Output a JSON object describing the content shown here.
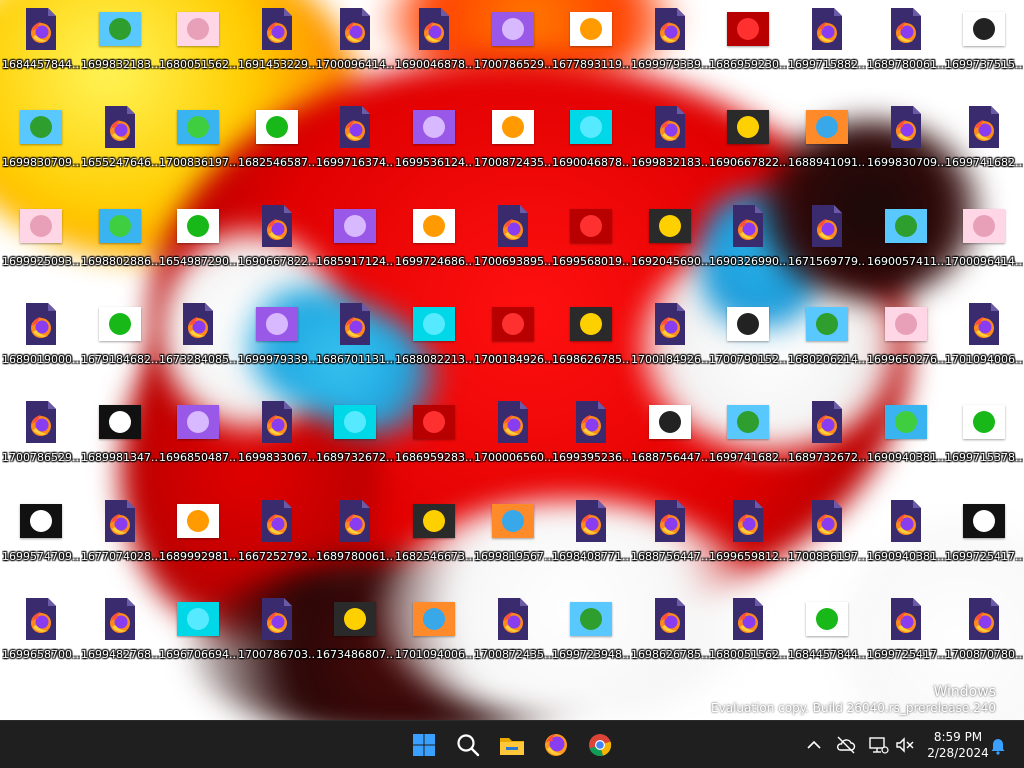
{
  "desktop": {
    "icons": [
      {
        "label": "1684457844....",
        "kind": "firefox-icon"
      },
      {
        "label": "1699832183....",
        "kind": "image"
      },
      {
        "label": "1680051562....",
        "kind": "image"
      },
      {
        "label": "1691453229....",
        "kind": "firefox-icon"
      },
      {
        "label": "1700096414....",
        "kind": "firefox-icon"
      },
      {
        "label": "1690046878....",
        "kind": "firefox-icon"
      },
      {
        "label": "1700786529....",
        "kind": "image"
      },
      {
        "label": "1677893119....",
        "kind": "image"
      },
      {
        "label": "1699979339....",
        "kind": "firefox-icon"
      },
      {
        "label": "1686959230....",
        "kind": "image"
      },
      {
        "label": "1699715882....",
        "kind": "firefox-icon"
      },
      {
        "label": "1689780061....",
        "kind": "firefox-icon"
      },
      {
        "label": "1699737515....",
        "kind": "image"
      },
      {
        "label": "1699830709....",
        "kind": "image"
      },
      {
        "label": "1655247646....",
        "kind": "firefox-icon"
      },
      {
        "label": "1700836197....",
        "kind": "image"
      },
      {
        "label": "1682546587....",
        "kind": "image"
      },
      {
        "label": "1699716374....",
        "kind": "firefox-icon"
      },
      {
        "label": "1699536124....",
        "kind": "image"
      },
      {
        "label": "1700872435....",
        "kind": "image"
      },
      {
        "label": "1690046878....",
        "kind": "image"
      },
      {
        "label": "1699832183....",
        "kind": "firefox-icon"
      },
      {
        "label": "1690667822....",
        "kind": "image"
      },
      {
        "label": "1688941091....",
        "kind": "image"
      },
      {
        "label": "1699830709....",
        "kind": "firefox-icon"
      },
      {
        "label": "1699741682....",
        "kind": "firefox-icon"
      },
      {
        "label": "1699925093....",
        "kind": "image"
      },
      {
        "label": "1698802886....",
        "kind": "image"
      },
      {
        "label": "1654987290....",
        "kind": "image"
      },
      {
        "label": "1690667822....",
        "kind": "firefox-icon"
      },
      {
        "label": "1685917124....",
        "kind": "image"
      },
      {
        "label": "1699724686....",
        "kind": "image"
      },
      {
        "label": "1700693895....",
        "kind": "firefox-icon"
      },
      {
        "label": "1699568019....",
        "kind": "image"
      },
      {
        "label": "1692045690....",
        "kind": "image"
      },
      {
        "label": "1690326990....",
        "kind": "firefox-icon"
      },
      {
        "label": "1671569779....",
        "kind": "firefox-icon"
      },
      {
        "label": "1690057411....",
        "kind": "image"
      },
      {
        "label": "1700096414....",
        "kind": "image"
      },
      {
        "label": "1689019000....",
        "kind": "firefox-icon"
      },
      {
        "label": "1679184682....",
        "kind": "image"
      },
      {
        "label": "1673284085....",
        "kind": "firefox-icon"
      },
      {
        "label": "1699979339....",
        "kind": "image"
      },
      {
        "label": "1686701131....",
        "kind": "firefox-icon"
      },
      {
        "label": "1688082213....",
        "kind": "image"
      },
      {
        "label": "1700184926....",
        "kind": "image"
      },
      {
        "label": "1698626785....",
        "kind": "image"
      },
      {
        "label": "1700184926....",
        "kind": "firefox-icon"
      },
      {
        "label": "1700790152....",
        "kind": "image"
      },
      {
        "label": "1680206214....",
        "kind": "image"
      },
      {
        "label": "1699650276....",
        "kind": "image"
      },
      {
        "label": "1701094006....",
        "kind": "firefox-icon"
      },
      {
        "label": "1700786529....",
        "kind": "firefox-icon"
      },
      {
        "label": "1689981347....",
        "kind": "image"
      },
      {
        "label": "1696850487....",
        "kind": "image"
      },
      {
        "label": "1699833067....",
        "kind": "firefox-icon"
      },
      {
        "label": "1689732672....",
        "kind": "image"
      },
      {
        "label": "1686959283....",
        "kind": "image"
      },
      {
        "label": "1700006560....",
        "kind": "firefox-icon"
      },
      {
        "label": "1699395236....",
        "kind": "firefox-icon"
      },
      {
        "label": "1688756447....",
        "kind": "image"
      },
      {
        "label": "1699741682....",
        "kind": "image"
      },
      {
        "label": "1689732672....",
        "kind": "firefox-icon"
      },
      {
        "label": "1690940381....",
        "kind": "image"
      },
      {
        "label": "1699715378....",
        "kind": "image"
      },
      {
        "label": "1699574709....",
        "kind": "image"
      },
      {
        "label": "1677074028....",
        "kind": "firefox-icon"
      },
      {
        "label": "1689992981....",
        "kind": "image"
      },
      {
        "label": "1667252792....",
        "kind": "firefox-icon"
      },
      {
        "label": "1689780061....",
        "kind": "firefox-icon"
      },
      {
        "label": "1682546673....",
        "kind": "image"
      },
      {
        "label": "1699819567....",
        "kind": "image"
      },
      {
        "label": "1698408771....",
        "kind": "firefox-icon"
      },
      {
        "label": "1688756447....",
        "kind": "firefox-icon"
      },
      {
        "label": "1699659812....",
        "kind": "firefox-icon"
      },
      {
        "label": "1700836197....",
        "kind": "firefox-icon"
      },
      {
        "label": "1690940381....",
        "kind": "firefox-icon"
      },
      {
        "label": "1699725417....",
        "kind": "image"
      },
      {
        "label": "1699658700....",
        "kind": "firefox-icon"
      },
      {
        "label": "1699482768....",
        "kind": "firefox-icon"
      },
      {
        "label": "1696706694....",
        "kind": "image"
      },
      {
        "label": "1700786703....",
        "kind": "firefox-icon"
      },
      {
        "label": "1673486807....",
        "kind": "image"
      },
      {
        "label": "1701094006....",
        "kind": "image"
      },
      {
        "label": "1700872435....",
        "kind": "firefox-icon"
      },
      {
        "label": "1699723948....",
        "kind": "image"
      },
      {
        "label": "1698626785....",
        "kind": "firefox-icon"
      },
      {
        "label": "1680051562....",
        "kind": "firefox-icon"
      },
      {
        "label": "1684457844....",
        "kind": "image"
      },
      {
        "label": "1699725417....",
        "kind": "firefox-icon"
      },
      {
        "label": "1700870780....",
        "kind": "firefox-icon"
      }
    ]
  },
  "watermark": {
    "line1": "Windows",
    "line2": "Evaluation copy. Build 26040.rs_prerelease.240"
  },
  "taskbar": {
    "pinned": [
      {
        "name": "start-button",
        "icon": "windows-logo-icon"
      },
      {
        "name": "search-button",
        "icon": "search-icon"
      },
      {
        "name": "file-explorer-button",
        "icon": "folder-icon"
      },
      {
        "name": "firefox-button",
        "icon": "firefox-icon"
      },
      {
        "name": "chrome-button",
        "icon": "chrome-icon"
      }
    ],
    "tray": [
      {
        "name": "show-hidden-icons-button",
        "icon": "chevron-up-icon"
      },
      {
        "name": "onedrive-button",
        "icon": "cloud-off-icon"
      },
      {
        "name": "network-button",
        "icon": "network-icon"
      },
      {
        "name": "volume-button",
        "icon": "volume-muted-icon"
      }
    ],
    "clock": {
      "time": "8:59 PM",
      "date": "2/28/2024"
    },
    "notifications_icon": "bell-icon"
  },
  "colors": {
    "taskbar_bg": "#1f1f1f",
    "firefox_doc_bg": "#3a2a6e",
    "firefox_orange": "#ff7a1a",
    "firefox_purple": "#8a3cf0",
    "accent_blue": "#2a8cff"
  }
}
